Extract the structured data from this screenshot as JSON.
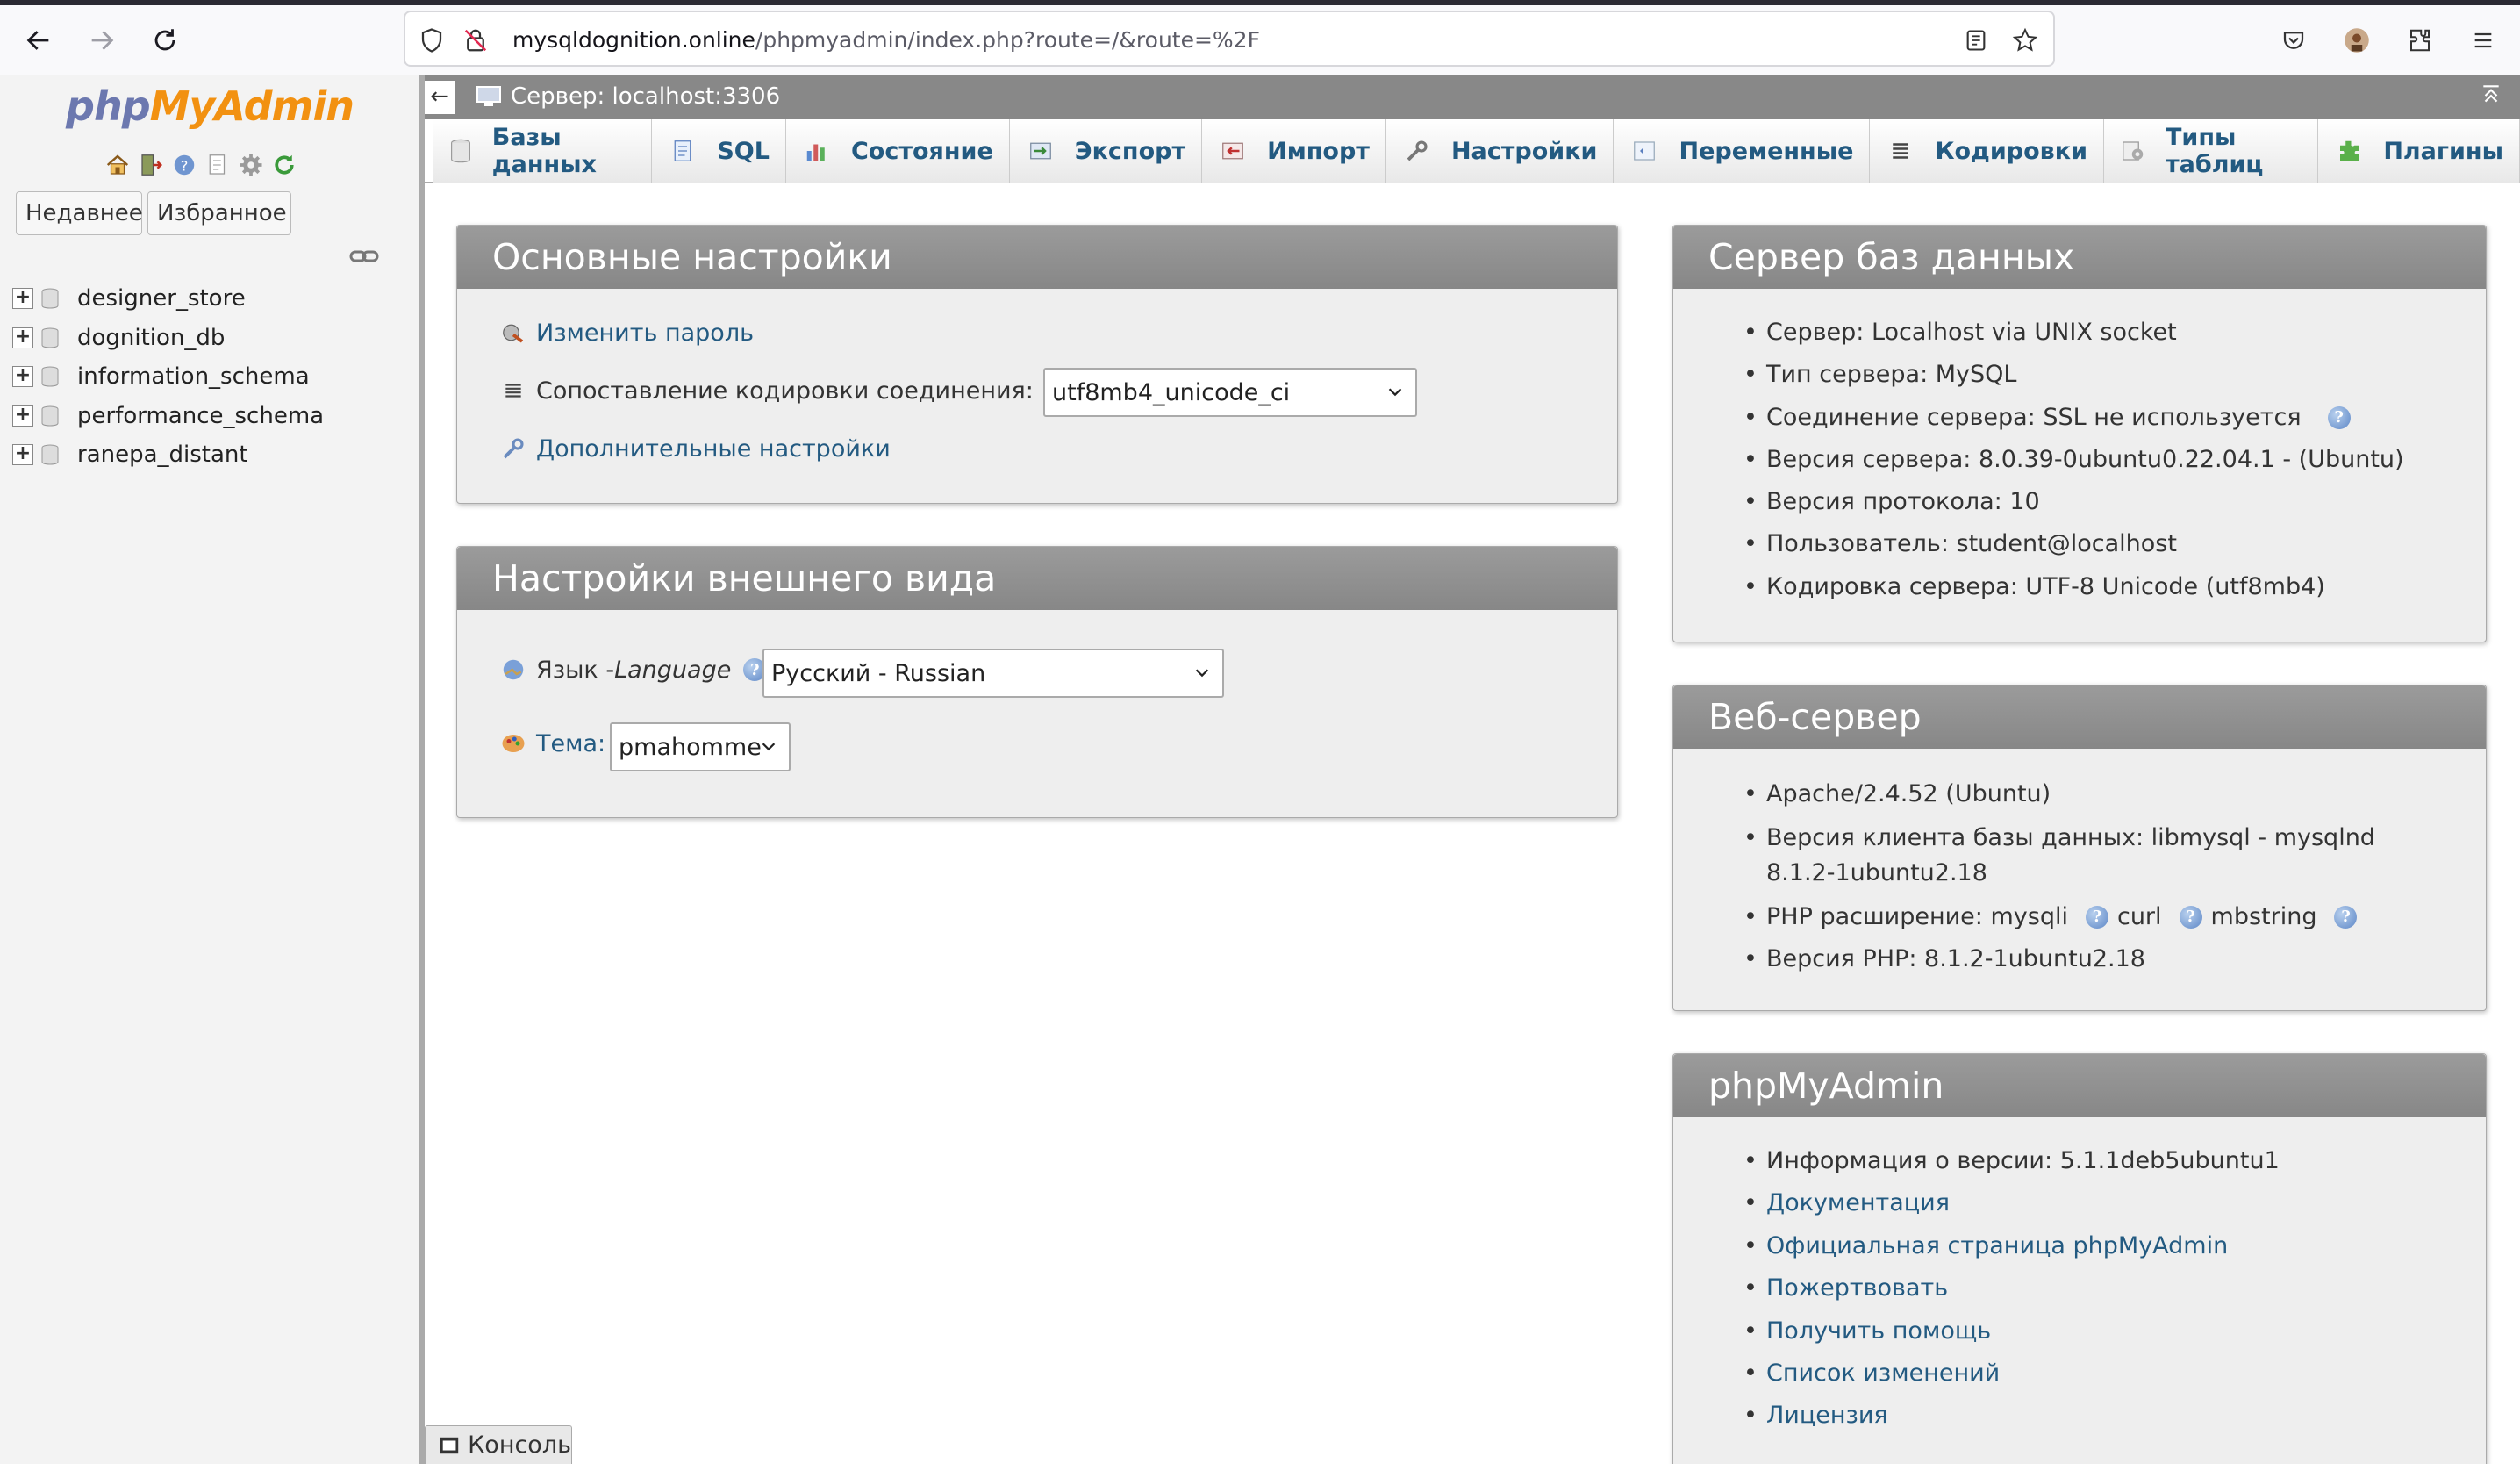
{
  "browser": {
    "url_host": "mysqldognition.online",
    "url_path": "/phpmyadmin/index.php?route=/&route=%2F"
  },
  "nav": {
    "logo_php": "php",
    "logo_myadmin": "MyAdmin",
    "recent_label": "Недавнее",
    "favorites_label": "Избранное",
    "databases": [
      "designer_store",
      "dognition_db",
      "information_schema",
      "performance_schema",
      "ranepa_distant"
    ]
  },
  "server_bar": {
    "label": "Сервер: localhost:3306"
  },
  "tabs": [
    {
      "label": "Базы данных",
      "icon": "database-icon"
    },
    {
      "label": "SQL",
      "icon": "sql-icon"
    },
    {
      "label": "Состояние",
      "icon": "status-icon"
    },
    {
      "label": "Экспорт",
      "icon": "export-icon"
    },
    {
      "label": "Импорт",
      "icon": "import-icon"
    },
    {
      "label": "Настройки",
      "icon": "settings-wrench-icon"
    },
    {
      "label": "Переменные",
      "icon": "variables-icon"
    },
    {
      "label": "Кодировки",
      "icon": "charset-icon"
    },
    {
      "label": "Типы таблиц",
      "icon": "engines-icon"
    },
    {
      "label": "Плагины",
      "icon": "plugins-icon"
    }
  ],
  "general_settings": {
    "title": "Основные настройки",
    "change_password": "Изменить пароль",
    "collation_label": "Сопоставление кодировки соединения:",
    "collation_value": "utf8mb4_unicode_ci",
    "more_settings": "Дополнительные настройки"
  },
  "appearance": {
    "title": "Настройки внешнего вида",
    "language_label": "Язык - ",
    "language_label_en": "Language",
    "language_value": "Русский - Russian",
    "theme_label": "Тема:",
    "theme_value": "pmahomme"
  },
  "db_server": {
    "title": "Сервер баз данных",
    "items": [
      "Сервер: Localhost via UNIX socket",
      "Тип сервера: MySQL",
      "Соединение сервера: SSL не используется",
      "Версия сервера: 8.0.39-0ubuntu0.22.04.1 - (Ubuntu)",
      "Версия протокола: 10",
      "Пользователь: student@localhost",
      "Кодировка сервера: UTF-8 Unicode (utf8mb4)"
    ]
  },
  "web_server": {
    "title": "Веб-сервер",
    "apache": "Apache/2.4.52 (Ubuntu)",
    "client_version_line1": "Версия клиента базы данных: libmysql - mysqlnd",
    "client_version_line2": "8.1.2-1ubuntu2.18",
    "php_ext_label": "PHP расширение: mysqli",
    "php_ext_curl": "curl",
    "php_ext_mbstring": "mbstring",
    "php_version": "Версия PHP: 8.1.2-1ubuntu2.18"
  },
  "pma_panel": {
    "title": "phpMyAdmin",
    "version_info": "Информация о версии: 5.1.1deb5ubuntu1",
    "links": [
      "Документация",
      "Официальная страница phpMyAdmin",
      "Пожертвовать",
      "Получить помощь",
      "Список изменений",
      "Лицензия"
    ]
  },
  "console": {
    "label": "Консоль"
  },
  "colors": {
    "link": "#235a81",
    "panel_header": "#8f8f8f",
    "logo_php": "#6c78af",
    "logo_myadmin": "#f29111"
  }
}
